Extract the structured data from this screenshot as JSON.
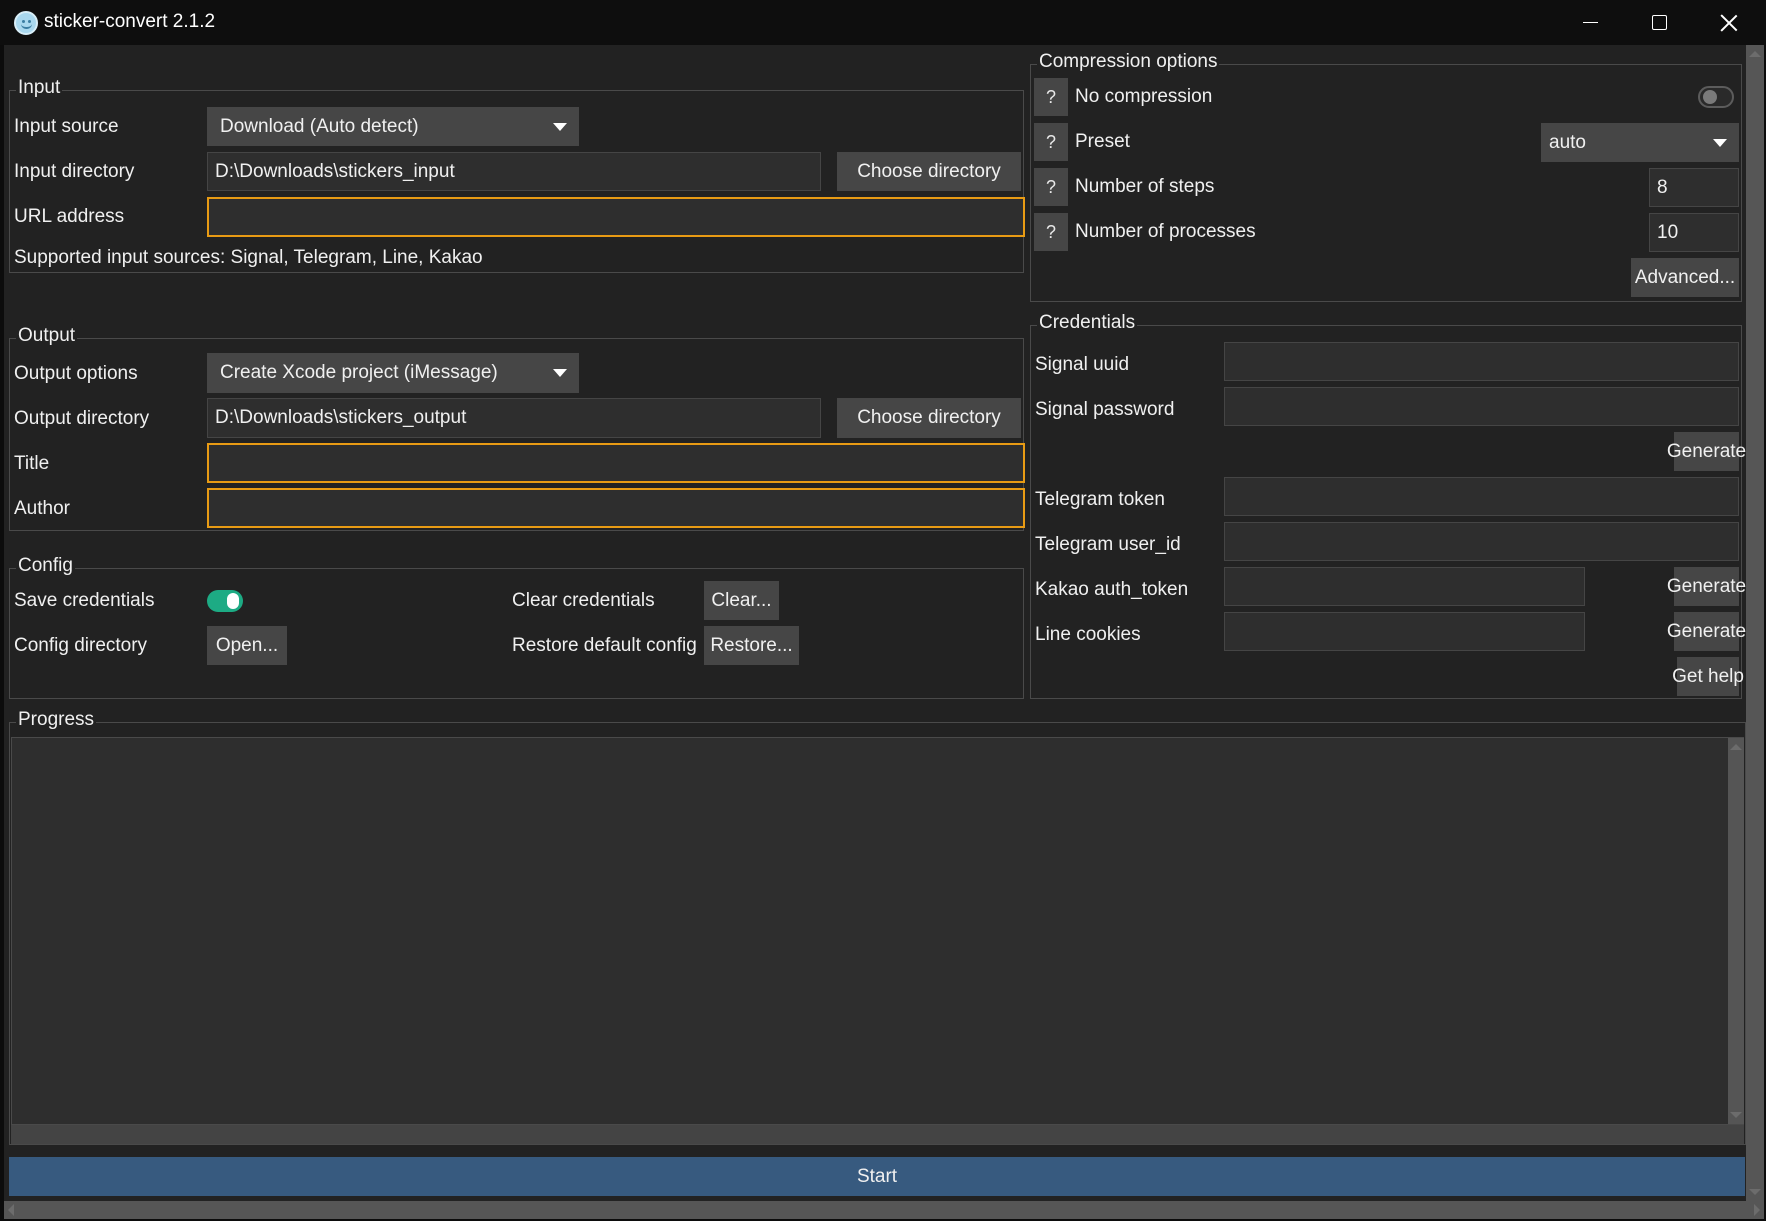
{
  "window": {
    "title": "sticker-convert 2.1.2",
    "icon": "smiley-sticker-icon",
    "controls": {
      "minimize": "minimize-icon",
      "maximize": "maximize-icon",
      "close": "close-icon"
    }
  },
  "input": {
    "group_title": "Input",
    "source_label": "Input source",
    "source_value": "Download (Auto detect)",
    "directory_label": "Input directory",
    "directory_value": "D:\\Downloads\\stickers_input",
    "choose_directory_label": "Choose directory",
    "url_label": "URL address",
    "url_value": "",
    "supported_text": "Supported input sources: Signal, Telegram, Line, Kakao"
  },
  "output": {
    "group_title": "Output",
    "options_label": "Output options",
    "options_value": "Create Xcode project (iMessage)",
    "directory_label": "Output directory",
    "directory_value": "D:\\Downloads\\stickers_output",
    "choose_directory_label": "Choose directory",
    "title_label": "Title",
    "title_value": "",
    "author_label": "Author",
    "author_value": ""
  },
  "config": {
    "group_title": "Config",
    "save_credentials_label": "Save credentials",
    "save_credentials_on": true,
    "clear_credentials_label": "Clear credentials",
    "clear_button": "Clear...",
    "config_directory_label": "Config directory",
    "open_button": "Open...",
    "restore_label": "Restore default config",
    "restore_button": "Restore..."
  },
  "compression": {
    "group_title": "Compression options",
    "help_glyph": "?",
    "no_compression_label": "No compression",
    "no_compression_on": false,
    "preset_label": "Preset",
    "preset_value": "auto",
    "steps_label": "Number of steps",
    "steps_value": "8",
    "processes_label": "Number of processes",
    "processes_value": "10",
    "advanced_button": "Advanced..."
  },
  "credentials": {
    "group_title": "Credentials",
    "signal_uuid_label": "Signal uuid",
    "signal_uuid_value": "",
    "signal_password_label": "Signal password",
    "signal_password_value": "",
    "signal_generate_button": "Generate",
    "telegram_token_label": "Telegram token",
    "telegram_token_value": "",
    "telegram_userid_label": "Telegram user_id",
    "telegram_userid_value": "",
    "kakao_label": "Kakao auth_token",
    "kakao_value": "",
    "kakao_generate_button": "Generate",
    "line_label": "Line cookies",
    "line_value": "",
    "line_generate_button": "Generate",
    "get_help_button": "Get help"
  },
  "progress": {
    "group_title": "Progress",
    "log_text": "",
    "bar_value_percent": 0
  },
  "start_button": "Start",
  "colors": {
    "accent_required": "#e89b14",
    "toggle_on": "#1dab84",
    "start_button": "#375a7f",
    "background": "#222222"
  }
}
